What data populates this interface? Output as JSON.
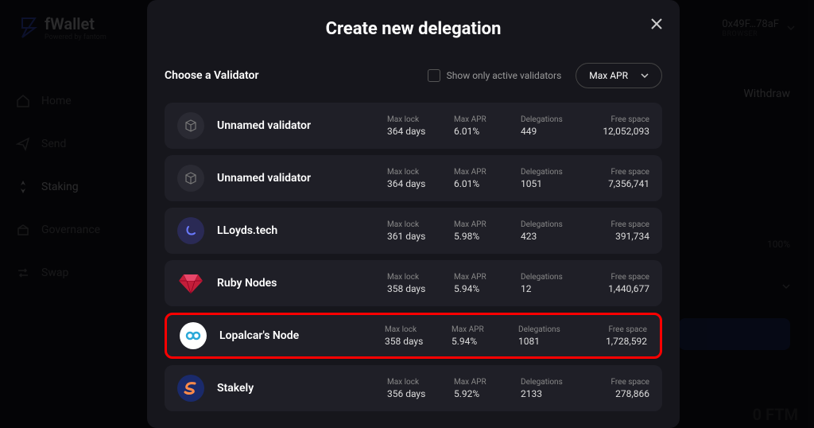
{
  "app": {
    "logo_text": "fWallet",
    "logo_sub": "Powered by fantom"
  },
  "wallet": {
    "address": "0x49F…78aF",
    "network": "BROWSER"
  },
  "sidebar": {
    "items": [
      {
        "label": "Home"
      },
      {
        "label": "Send"
      },
      {
        "label": "Staking"
      },
      {
        "label": "Governance"
      },
      {
        "label": "Swap"
      }
    ]
  },
  "bg": {
    "withdraw": "Withdraw",
    "pct": "100%",
    "ftm": "0 FTM"
  },
  "modal": {
    "title": "Create new delegation",
    "choose_label": "Choose a Validator",
    "checkbox_label": "Show only active validators",
    "sort_label": "Max APR",
    "col_labels": {
      "maxlock": "Max lock",
      "maxapr": "Max APR",
      "delegations": "Delegations",
      "freespace": "Free space"
    },
    "validators": [
      {
        "name": "Unnamed validator",
        "maxlock": "364 days",
        "maxapr": "6.01%",
        "delegations": "449",
        "freespace": "12,052,093",
        "icon": "cube"
      },
      {
        "name": "Unnamed validator",
        "maxlock": "364 days",
        "maxapr": "6.01%",
        "delegations": "1051",
        "freespace": "7,356,741",
        "icon": "cube"
      },
      {
        "name": "LLoyds.tech",
        "maxlock": "361 days",
        "maxapr": "5.98%",
        "delegations": "423",
        "freespace": "391,734",
        "icon": "lloyds"
      },
      {
        "name": "Ruby Nodes",
        "maxlock": "358 days",
        "maxapr": "5.94%",
        "delegations": "12",
        "freespace": "1,440,677",
        "icon": "ruby"
      },
      {
        "name": "Lopalcar's Node",
        "maxlock": "358 days",
        "maxapr": "5.94%",
        "delegations": "1081",
        "freespace": "1,728,592",
        "icon": "lopalcar",
        "highlighted": true
      },
      {
        "name": "Stakely",
        "maxlock": "356 days",
        "maxapr": "5.92%",
        "delegations": "2133",
        "freespace": "278,866",
        "icon": "stakely"
      }
    ]
  }
}
